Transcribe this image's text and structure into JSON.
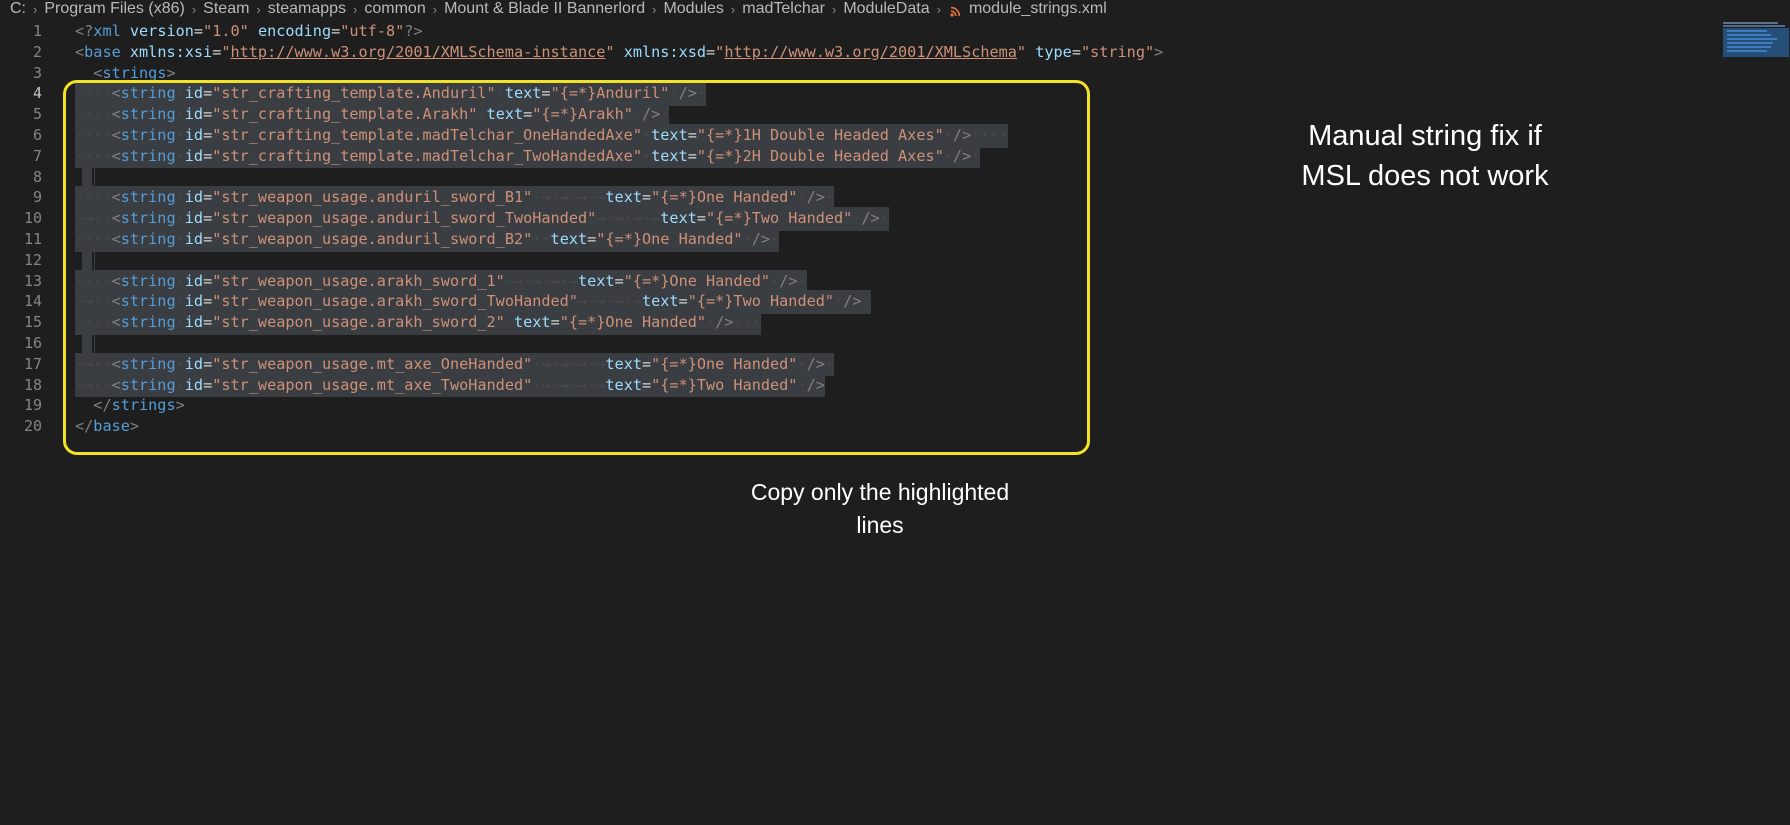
{
  "breadcrumb": [
    "C:",
    "Program Files (x86)",
    "Steam",
    "steamapps",
    "common",
    "Mount & Blade II Bannerlord",
    "Modules",
    "madTelchar",
    "ModuleData"
  ],
  "file_name": "module_strings.xml",
  "icons": {
    "file_type": "rss-icon",
    "separator": "chevron-right-icon"
  },
  "colors": {
    "highlight_border": "#f2e424",
    "selection": "#3a3d41",
    "tag": "#569cd6",
    "attribute": "#9cdcfe",
    "string": "#ce9178"
  },
  "active_line": 4,
  "lines": [
    {
      "n": "1",
      "tokens": [
        [
          "punct",
          "<?"
        ],
        [
          "tag",
          "xml"
        ],
        [
          "text",
          " "
        ],
        [
          "attr",
          "version"
        ],
        [
          "text",
          "="
        ],
        [
          "str",
          "\"1.0\""
        ],
        [
          "text",
          " "
        ],
        [
          "attr",
          "encoding"
        ],
        [
          "text",
          "="
        ],
        [
          "str",
          "\"utf-8\""
        ],
        [
          "punct",
          "?>"
        ]
      ]
    },
    {
      "n": "2",
      "tokens": [
        [
          "punct",
          "<"
        ],
        [
          "tag",
          "base"
        ],
        [
          "text",
          " "
        ],
        [
          "attr",
          "xmlns:xsi"
        ],
        [
          "text",
          "="
        ],
        [
          "str",
          "\""
        ],
        [
          "url",
          "http://www.w3.org/2001/XMLSchema-instance"
        ],
        [
          "str",
          "\""
        ],
        [
          "text",
          " "
        ],
        [
          "attr",
          "xmlns:xsd"
        ],
        [
          "text",
          "="
        ],
        [
          "str",
          "\""
        ],
        [
          "url",
          "http://www.w3.org/2001/XMLSchema"
        ],
        [
          "str",
          "\""
        ],
        [
          "text",
          " "
        ],
        [
          "attr",
          "type"
        ],
        [
          "text",
          "="
        ],
        [
          "str",
          "\"string\""
        ],
        [
          "punct",
          ">"
        ]
      ]
    },
    {
      "n": "3",
      "tokens": [
        [
          "text",
          "  "
        ],
        [
          "punct",
          "<"
        ],
        [
          "tag",
          "strings"
        ],
        [
          "punct",
          ">"
        ]
      ]
    },
    {
      "n": "4",
      "sel": true,
      "tokens": [
        [
          "ws",
          "····"
        ],
        [
          "punct",
          "<"
        ],
        [
          "tag",
          "string"
        ],
        [
          "ws",
          "·"
        ],
        [
          "attr",
          "id"
        ],
        [
          "text",
          "="
        ],
        [
          "str",
          "\"str_crafting_template.Anduril\""
        ],
        [
          "ws",
          "·"
        ],
        [
          "attr",
          "text"
        ],
        [
          "text",
          "="
        ],
        [
          "str",
          "\"{=*}Anduril\""
        ],
        [
          "ws",
          "·"
        ],
        [
          "punct",
          "/>"
        ],
        [
          "ws",
          "·"
        ]
      ]
    },
    {
      "n": "5",
      "sel": true,
      "tokens": [
        [
          "ws",
          "····"
        ],
        [
          "punct",
          "<"
        ],
        [
          "tag",
          "string"
        ],
        [
          "ws",
          "·"
        ],
        [
          "attr",
          "id"
        ],
        [
          "text",
          "="
        ],
        [
          "str",
          "\"str_crafting_template.Arakh\""
        ],
        [
          "ws",
          "·"
        ],
        [
          "attr",
          "text"
        ],
        [
          "text",
          "="
        ],
        [
          "str",
          "\"{=*}Arakh\""
        ],
        [
          "ws",
          "·"
        ],
        [
          "punct",
          "/>"
        ],
        [
          "ws",
          "·"
        ]
      ]
    },
    {
      "n": "6",
      "sel": true,
      "tokens": [
        [
          "ws",
          "····"
        ],
        [
          "punct",
          "<"
        ],
        [
          "tag",
          "string"
        ],
        [
          "ws",
          "·"
        ],
        [
          "attr",
          "id"
        ],
        [
          "text",
          "="
        ],
        [
          "str",
          "\"str_crafting_template.madTelchar_OneHandedAxe\""
        ],
        [
          "ws",
          "·"
        ],
        [
          "attr",
          "text"
        ],
        [
          "text",
          "="
        ],
        [
          "str",
          "\"{=*}1H Double Headed Axes\""
        ],
        [
          "ws",
          "·"
        ],
        [
          "punct",
          "/>"
        ],
        [
          "ws",
          "····"
        ]
      ]
    },
    {
      "n": "7",
      "sel": true,
      "tokens": [
        [
          "ws",
          "····"
        ],
        [
          "punct",
          "<"
        ],
        [
          "tag",
          "string"
        ],
        [
          "ws",
          "·"
        ],
        [
          "attr",
          "id"
        ],
        [
          "text",
          "="
        ],
        [
          "str",
          "\"str_crafting_template.madTelchar_TwoHandedAxe\""
        ],
        [
          "ws",
          "·"
        ],
        [
          "attr",
          "text"
        ],
        [
          "text",
          "="
        ],
        [
          "str",
          "\"{=*}2H Double Headed Axes\""
        ],
        [
          "ws",
          "·"
        ],
        [
          "punct",
          "/>"
        ],
        [
          "ws",
          "·"
        ]
      ]
    },
    {
      "n": "8",
      "emptysel": true,
      "tokens": []
    },
    {
      "n": "9",
      "sel": true,
      "tokens": [
        [
          "ws",
          "›···"
        ],
        [
          "punct",
          "<"
        ],
        [
          "tag",
          "string"
        ],
        [
          "ws",
          "·"
        ],
        [
          "attr",
          "id"
        ],
        [
          "text",
          "="
        ],
        [
          "str",
          "\"str_weapon_usage.anduril_sword_B1\""
        ],
        [
          "ws",
          "·→·→·→·→"
        ],
        [
          "attr",
          "text"
        ],
        [
          "text",
          "="
        ],
        [
          "str",
          "\"{=*}One Handed\""
        ],
        [
          "ws",
          "·"
        ],
        [
          "punct",
          "/>"
        ],
        [
          "ws",
          "·"
        ]
      ]
    },
    {
      "n": "10",
      "sel": true,
      "tokens": [
        [
          "ws",
          "·→··"
        ],
        [
          "punct",
          "<"
        ],
        [
          "tag",
          "string"
        ],
        [
          "ws",
          "·"
        ],
        [
          "attr",
          "id"
        ],
        [
          "text",
          "="
        ],
        [
          "str",
          "\"str_weapon_usage.anduril_sword_TwoHanded\""
        ],
        [
          "ws",
          "→·→·→·→"
        ],
        [
          "attr",
          "text"
        ],
        [
          "text",
          "="
        ],
        [
          "str",
          "\"{=*}Two Handed\""
        ],
        [
          "ws",
          "·"
        ],
        [
          "punct",
          "/>"
        ],
        [
          "ws",
          "·"
        ]
      ]
    },
    {
      "n": "11",
      "sel": true,
      "tokens": [
        [
          "ws",
          "····"
        ],
        [
          "punct",
          "<"
        ],
        [
          "tag",
          "string"
        ],
        [
          "ws",
          "·"
        ],
        [
          "attr",
          "id"
        ],
        [
          "text",
          "="
        ],
        [
          "str",
          "\"str_weapon_usage.anduril_sword_B2\""
        ],
        [
          "ws",
          "··"
        ],
        [
          "attr",
          "text"
        ],
        [
          "text",
          "="
        ],
        [
          "str",
          "\"{=*}One Handed\""
        ],
        [
          "ws",
          "·"
        ],
        [
          "punct",
          "/>"
        ],
        [
          "ws",
          "·"
        ]
      ]
    },
    {
      "n": "12",
      "emptysel": true,
      "tokens": []
    },
    {
      "n": "13",
      "sel": true,
      "tokens": [
        [
          "ws",
          "····"
        ],
        [
          "punct",
          "<"
        ],
        [
          "tag",
          "string"
        ],
        [
          "ws",
          "·"
        ],
        [
          "attr",
          "id"
        ],
        [
          "text",
          "="
        ],
        [
          "str",
          "\"str_weapon_usage.arakh_sword_1\""
        ],
        [
          "ws",
          "·→·→·→·→"
        ],
        [
          "attr",
          "text"
        ],
        [
          "text",
          "="
        ],
        [
          "str",
          "\"{=*}One Handed\""
        ],
        [
          "ws",
          "·"
        ],
        [
          "punct",
          "/>"
        ],
        [
          "ws",
          "·"
        ]
      ]
    },
    {
      "n": "14",
      "sel": true,
      "tokens": [
        [
          "ws",
          "·→··"
        ],
        [
          "punct",
          "<"
        ],
        [
          "tag",
          "string"
        ],
        [
          "ws",
          "·"
        ],
        [
          "attr",
          "id"
        ],
        [
          "text",
          "="
        ],
        [
          "str",
          "\"str_weapon_usage.arakh_sword_TwoHanded\""
        ],
        [
          "ws",
          "→·→·→·→"
        ],
        [
          "attr",
          "text"
        ],
        [
          "text",
          "="
        ],
        [
          "str",
          "\"{=*}Two Handed\""
        ],
        [
          "ws",
          "·"
        ],
        [
          "punct",
          "/>"
        ],
        [
          "ws",
          "·"
        ]
      ]
    },
    {
      "n": "15",
      "sel": true,
      "tokens": [
        [
          "ws",
          "····"
        ],
        [
          "punct",
          "<"
        ],
        [
          "tag",
          "string"
        ],
        [
          "ws",
          "·"
        ],
        [
          "attr",
          "id"
        ],
        [
          "text",
          "="
        ],
        [
          "str",
          "\"str_weapon_usage.arakh_sword_2\""
        ],
        [
          "ws",
          "·"
        ],
        [
          "attr",
          "text"
        ],
        [
          "text",
          "="
        ],
        [
          "str",
          "\"{=*}One Handed\""
        ],
        [
          "ws",
          "·"
        ],
        [
          "punct",
          "/>"
        ],
        [
          "ws",
          "···"
        ]
      ]
    },
    {
      "n": "16",
      "emptysel": true,
      "tokens": []
    },
    {
      "n": "17",
      "sel": true,
      "tokens": [
        [
          "ws",
          "·→··"
        ],
        [
          "punct",
          "<"
        ],
        [
          "tag",
          "string"
        ],
        [
          "ws",
          "·"
        ],
        [
          "attr",
          "id"
        ],
        [
          "text",
          "="
        ],
        [
          "str",
          "\"str_weapon_usage.mt_axe_OneHanded\""
        ],
        [
          "ws",
          "·→·→·→·→"
        ],
        [
          "attr",
          "text"
        ],
        [
          "text",
          "="
        ],
        [
          "str",
          "\"{=*}One Handed\""
        ],
        [
          "ws",
          "·"
        ],
        [
          "punct",
          "/>"
        ],
        [
          "ws",
          "·"
        ]
      ]
    },
    {
      "n": "18",
      "sel": true,
      "tokens": [
        [
          "ws",
          "·→··"
        ],
        [
          "punct",
          "<"
        ],
        [
          "tag",
          "string"
        ],
        [
          "ws",
          "·"
        ],
        [
          "attr",
          "id"
        ],
        [
          "text",
          "="
        ],
        [
          "str",
          "\"str_weapon_usage.mt_axe_TwoHanded\""
        ],
        [
          "ws",
          "·→·→·→·→"
        ],
        [
          "attr",
          "text"
        ],
        [
          "text",
          "="
        ],
        [
          "str",
          "\"{=*}Two Handed\""
        ],
        [
          "ws",
          "·"
        ],
        [
          "punct",
          "/>"
        ]
      ]
    },
    {
      "n": "19",
      "tokens": [
        [
          "text",
          "  "
        ],
        [
          "punct",
          "</"
        ],
        [
          "tag",
          "strings"
        ],
        [
          "punct",
          ">"
        ]
      ]
    },
    {
      "n": "20",
      "tokens": [
        [
          "punct",
          "</"
        ],
        [
          "tag",
          "base"
        ],
        [
          "punct",
          ">"
        ]
      ]
    }
  ],
  "annotations": {
    "right_note_line1": "Manual string fix if",
    "right_note_line2": "MSL does not work",
    "bottom_note_line1": "Copy only the highlighted",
    "bottom_note_line2": "lines"
  }
}
